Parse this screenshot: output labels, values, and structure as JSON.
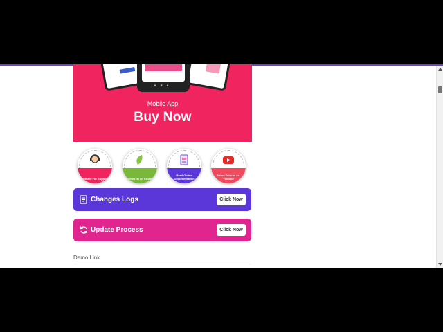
{
  "banner": {
    "subtitle": "Mobile App",
    "title": "Buy Now"
  },
  "circles": [
    {
      "label": "Contact For Support",
      "color": "#f0245e",
      "icon": "support-agent-icon"
    },
    {
      "label": "Follow us on Envato",
      "color": "#7ab83b",
      "icon": "envato-leaf-icon"
    },
    {
      "label": "Read Online Documentation",
      "color": "#5b36d8",
      "icon": "documentation-icon"
    },
    {
      "label": "Video Tutorial on Youtube",
      "color": "#f04a5e",
      "icon": "youtube-icon"
    }
  ],
  "changes": {
    "label": "Changes Logs",
    "button": "Click Now",
    "color": "#5b36d8",
    "icon": "document-icon"
  },
  "update": {
    "label": "Update Process",
    "button": "Click Now",
    "color": "#e0268e",
    "icon": "refresh-icon"
  },
  "demo": {
    "label": "Demo Link"
  }
}
